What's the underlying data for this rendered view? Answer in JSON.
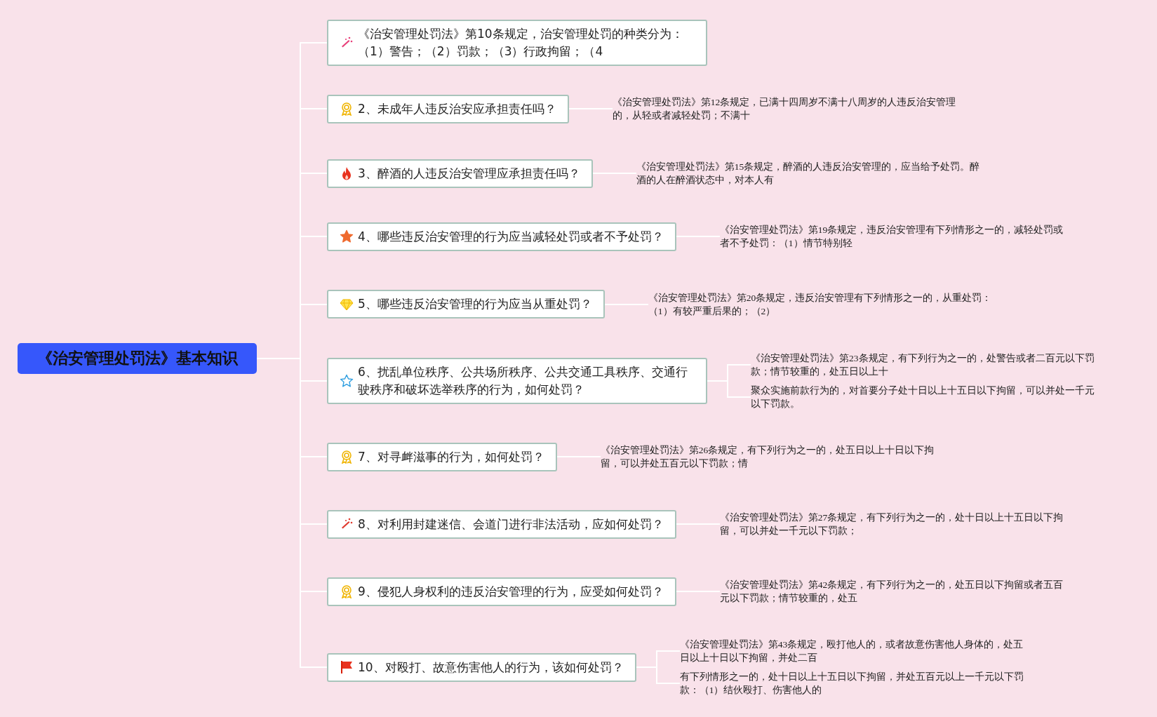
{
  "root": {
    "title": "《治安管理处罚法》基本知识"
  },
  "topics": [
    {
      "kind": "sparkle",
      "title": "《治安管理处罚法》第10条规定，治安管理处罚的种类分为：（1）警告；（2）罚款；（3）行政拘留；（4"
    },
    {
      "kind": "award",
      "title": "2、未成年人违反治安应承担责任吗？",
      "notes": [
        "《治安管理处罚法》第12条规定，已满十四周岁不满十八周岁的人违反治安管理的，从轻或者减轻处罚；不满十"
      ]
    },
    {
      "kind": "flame",
      "title": "3、醉酒的人违反治安管理应承担责任吗？",
      "notes": [
        "《治安管理处罚法》第15条规定，醉酒的人违反治安管理的，应当给予处罚。醉酒的人在醉酒状态中，对本人有"
      ]
    },
    {
      "kind": "star",
      "title": "4、哪些违反治安管理的行为应当减轻处罚或者不予处罚？",
      "notes": [
        "《治安管理处罚法》第19条规定，违反治安管理有下列情形之一的，减轻处罚或者不予处罚：（1）情节特别轻"
      ]
    },
    {
      "kind": "gem",
      "title": "5、哪些违反治安管理的行为应当从重处罚？",
      "notes": [
        "《治安管理处罚法》第20条规定，违反治安管理有下列情形之一的，从重处罚：（1）有较严重后果的；（2）"
      ]
    },
    {
      "kind": "star-outline",
      "title": "6、扰乱单位秩序、公共场所秩序、公共交通工具秩序、交通行驶秩序和破坏选举秩序的行为，如何处罚？",
      "notes": [
        "《治安管理处罚法》第23条规定，有下列行为之一的，处警告或者二百元以下罚款；情节较重的，处五日以上十",
        "聚众实施前款行为的，对首要分子处十日以上十五日以下拘留，可以并处一千元以下罚款。"
      ]
    },
    {
      "kind": "award",
      "title": "7、对寻衅滋事的行为，如何处罚？",
      "notes": [
        "《治安管理处罚法》第26条规定，有下列行为之一的，处五日以上十日以下拘留，可以并处五百元以下罚款；情"
      ]
    },
    {
      "kind": "sparkle-red",
      "title": "8、对利用封建迷信、会道门进行非法活动，应如何处罚？",
      "notes": [
        "《治安管理处罚法》第27条规定，有下列行为之一的，处十日以上十五日以下拘留，可以并处一千元以下罚款；"
      ]
    },
    {
      "kind": "award",
      "title": "9、侵犯人身权利的违反治安管理的行为，应受如何处罚？",
      "notes": [
        "《治安管理处罚法》第42条规定，有下列行为之一的，处五日以下拘留或者五百元以下罚款；情节较重的，处五"
      ]
    },
    {
      "kind": "flag",
      "title": "10、对殴打、故意伤害他人的行为，该如何处罚？",
      "notes": [
        "《治安管理处罚法》第43条规定，殴打他人的，或者故意伤害他人身体的，处五日以上十日以下拘留，并处二百",
        "有下列情形之一的，处十日以上十五日以下拘留，并处五百元以上一千元以下罚款：（1）结伙殴打、伤害他人的"
      ]
    }
  ]
}
